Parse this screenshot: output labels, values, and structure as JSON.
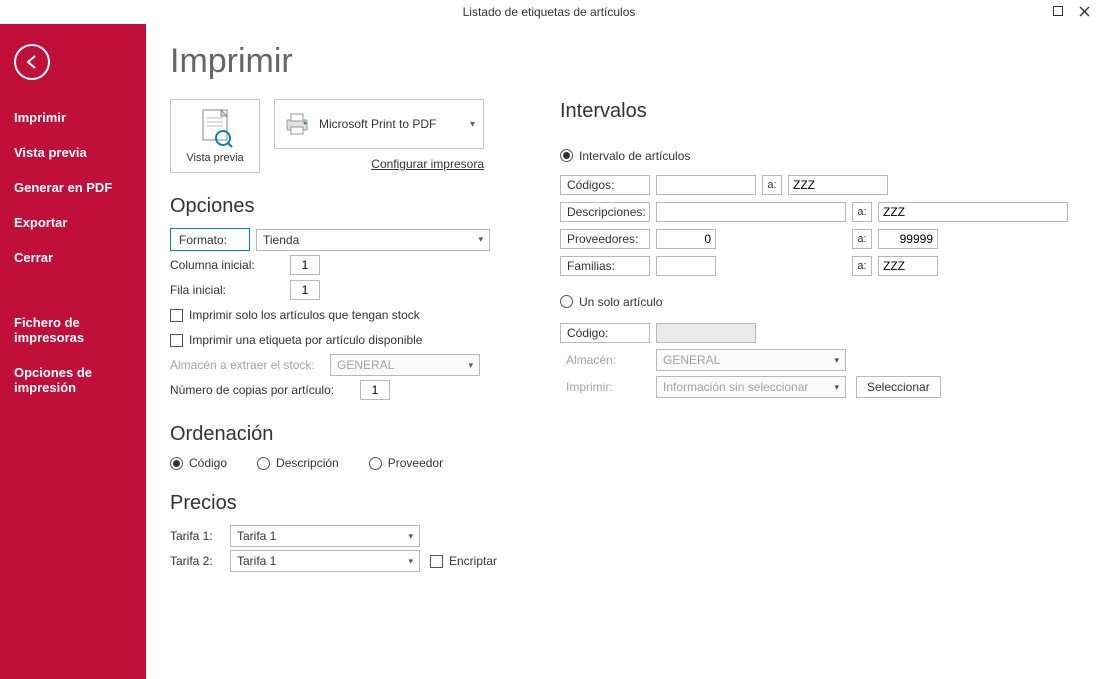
{
  "window": {
    "title": "Listado de etiquetas de artículos"
  },
  "sidebar": {
    "items": [
      "Imprimir",
      "Vista previa",
      "Generar en PDF",
      "Exportar",
      "Cerrar"
    ],
    "items2": [
      "Fichero de impresoras",
      "Opciones de impresión"
    ]
  },
  "main": {
    "heading": "Imprimir",
    "vista_previa_label": "Vista previa",
    "printer_name": "Microsoft Print to PDF",
    "configure_link": "Configurar impresora"
  },
  "opciones": {
    "heading": "Opciones",
    "formato_label": "Formato:",
    "formato_value": "Tienda",
    "col_ini_label": "Columna inicial:",
    "col_ini_value": "1",
    "fila_ini_label": "Fila inicial:",
    "fila_ini_value": "1",
    "cb_stock_label": "Imprimir solo los artículos que tengan stock",
    "cb_etiqueta_label": "Imprimir una etiqueta por artículo disponible",
    "almacen_label": "Almacén a extraer el stock:",
    "almacen_value": "GENERAL",
    "copias_label": "Número de copias por artículo:",
    "copias_value": "1"
  },
  "ordenacion": {
    "heading": "Ordenación",
    "opt_codigo": "Código",
    "opt_descripcion": "Descripción",
    "opt_proveedor": "Proveedor"
  },
  "precios": {
    "heading": "Precios",
    "tarifa1_label": "Tarifa 1:",
    "tarifa1_value": "Tarifa 1",
    "tarifa2_label": "Tarifa 2:",
    "tarifa2_value": "Tarifa 1",
    "encriptar_label": "Encriptar"
  },
  "intervalos": {
    "heading": "Intervalos",
    "radio_intervalo_label": "Intervalo de artículos",
    "radio_unico_label": "Un solo artículo",
    "codigos_label": "Códigos:",
    "codigos_from": "",
    "codigos_to": "ZZZ",
    "descripciones_label": "Descripciones:",
    "descripciones_from": "",
    "descripciones_to": "ZZZ",
    "proveedores_label": "Proveedores:",
    "proveedores_from": "0",
    "proveedores_to": "99999",
    "familias_label": "Familias:",
    "familias_from": "",
    "familias_to": "ZZZ",
    "a_label": "a:",
    "codigo_label": "Código:",
    "almacen_label": "Almacén:",
    "almacen_value": "GENERAL",
    "imprimir_label": "Imprimir:",
    "imprimir_value": "Información sin seleccionar",
    "seleccionar_btn": "Seleccionar"
  }
}
